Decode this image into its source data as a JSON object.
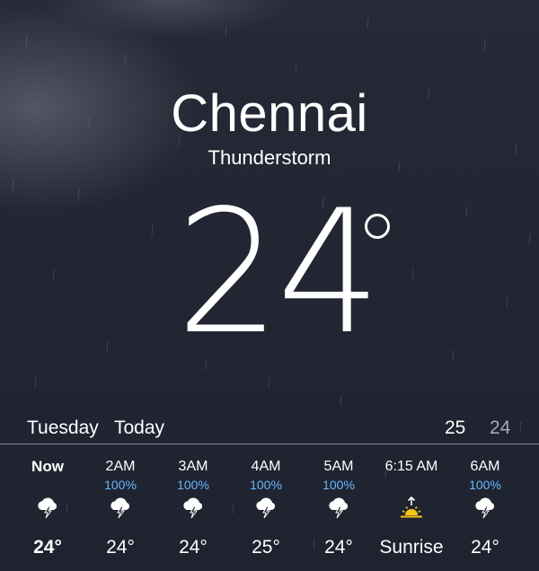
{
  "location": {
    "city": "Chennai",
    "condition": "Thunderstorm",
    "temperature": "24"
  },
  "today": {
    "day": "Tuesday",
    "label": "Today",
    "high": "25",
    "low": "24"
  },
  "hourly": [
    {
      "time": "Now",
      "precip": "",
      "icon": "thunderstorm-icon",
      "temp": "24°"
    },
    {
      "time": "2AM",
      "precip": "100%",
      "icon": "thunderstorm-icon",
      "temp": "24°"
    },
    {
      "time": "3AM",
      "precip": "100%",
      "icon": "thunderstorm-icon",
      "temp": "24°"
    },
    {
      "time": "4AM",
      "precip": "100%",
      "icon": "thunderstorm-icon",
      "temp": "25°"
    },
    {
      "time": "5AM",
      "precip": "100%",
      "icon": "thunderstorm-icon",
      "temp": "24°"
    },
    {
      "time": "6:15 AM",
      "precip": "",
      "icon": "sunrise-icon",
      "temp": "Sunrise"
    },
    {
      "time": "6AM",
      "precip": "100%",
      "icon": "thunderstorm-icon",
      "temp": "24°"
    }
  ],
  "colors": {
    "background": "#232734",
    "precip_accent": "#65b8ff",
    "sun_accent": "#f5c518",
    "low_temp": "#a6aab3"
  }
}
